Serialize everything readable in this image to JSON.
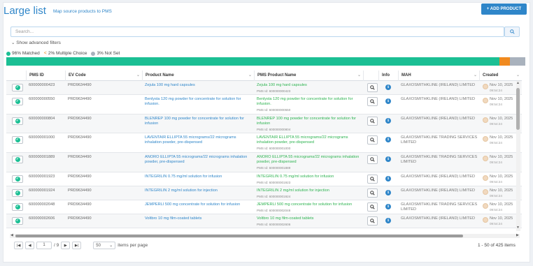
{
  "header": {
    "title": "Large list",
    "subtitle": "Map source products to PMS",
    "add_label": "+ ADD PRODUCT"
  },
  "search": {
    "placeholder": "Search..."
  },
  "filters": {
    "advanced_label": "Show advanced filters"
  },
  "stats": {
    "matched": "96% Matched",
    "multiple": "2% Multiple Choice",
    "not_set": "3% Not Set",
    "matched_fraction": 0.96,
    "multiple_fraction": 0.02,
    "not_set_fraction": 0.03
  },
  "columns": {
    "pms_id": "PMS ID",
    "ev_code": "EV Code",
    "product_name": "Product Name",
    "pms_product_name": "PMS Product Name",
    "info": "Info",
    "mah": "MAH",
    "created": "Created"
  },
  "rows": [
    {
      "pms_id": "600000000423",
      "ev_code": "PRD9634490",
      "product": "Zejula 100 mg hard capsules",
      "pms_product": "Zejula 100 mg hard capsules",
      "pms_sub": "PMS Id: 600000000423",
      "mah": "GLAXOSMITHKLINE (IRELAND) LIMITED",
      "date": "Nov 10, 2025",
      "time": "09:54:24"
    },
    {
      "pms_id": "600000000550",
      "ev_code": "PRD9634490",
      "product": "Benlysta 120 mg powder for concentrate for solution for infusion.",
      "pms_product": "Benlysta 120 mg powder for concentrate for solution for infusion.",
      "pms_sub": "PMS Id: 600000000550",
      "mah": "GLAXOSMITHKLINE (IRELAND) LIMITED",
      "date": "Nov 10, 2025",
      "time": "09:54:24"
    },
    {
      "pms_id": "600000000804",
      "ev_code": "PRD9634490",
      "product": "BLENREP 100 mg powder for concentrate for solution for infusion",
      "pms_product": "BLENREP 100 mg powder for concentrate for solution for infusion",
      "pms_sub": "PMS Id: 600000000804",
      "mah": "GLAXOSMITHKLINE (IRELAND) LIMITED",
      "date": "Nov 10, 2025",
      "time": "09:54:24"
    },
    {
      "pms_id": "600000001000",
      "ev_code": "PRD9634490",
      "product": "LAVENTAIR ELLIPTA 55 micrograms/22 micrograms inhalation powder, pre-dispensed",
      "pms_product": "LAVENTAIR ELLIPTA 55 micrograms/22 micrograms inhalation powder, pre-dispensed",
      "pms_sub": "PMS Id: 600000001000",
      "mah": "GLAXOSMITHKLINE TRADING SERVICES LIMITED",
      "date": "Nov 10, 2025",
      "time": "09:54:24"
    },
    {
      "pms_id": "600000001889",
      "ev_code": "PRD9634490",
      "product": "ANORO ELLIPTA 55 micrograms/22 micrograms inhalation powder, pre-dispensed",
      "pms_product": "ANORO ELLIPTA 55 micrograms/22 micrograms inhalation powder, pre-dispensed",
      "pms_sub": "PMS Id: 600000001889",
      "mah": "GLAXOSMITHKLINE TRADING SERVICES LIMITED",
      "date": "Nov 10, 2025",
      "time": "09:54:24"
    },
    {
      "pms_id": "600000001923",
      "ev_code": "PRD9634490",
      "product": "INTEGRILIN 0.75 mg/ml solution for infusion",
      "pms_product": "INTEGRILIN 0.75 mg/ml solution for infusion",
      "pms_sub": "PMS Id: 600000001923",
      "mah": "GLAXOSMITHKLINE (IRELAND) LIMITED",
      "date": "Nov 10, 2025",
      "time": "09:54:24"
    },
    {
      "pms_id": "600000001924",
      "ev_code": "PRD9634490",
      "product": "INTEGRILIN 2 mg/ml solution for injection",
      "pms_product": "INTEGRILIN 2 mg/ml solution for injection",
      "pms_sub": "PMS Id: 600000001924",
      "mah": "GLAXOSMITHKLINE (IRELAND) LIMITED",
      "date": "Nov 10, 2025",
      "time": "09:54:24"
    },
    {
      "pms_id": "600000002048",
      "ev_code": "PRD9634490",
      "product": "JEMPERLI 500 mg concentrate for solution for infusion",
      "pms_product": "JEMPERLI 500 mg concentrate for solution for infusion",
      "pms_sub": "PMS Id: 600000002048",
      "mah": "GLAXOSMITHKLINE TRADING SERVICES LIMITED",
      "date": "Nov 10, 2025",
      "time": "09:54:24"
    },
    {
      "pms_id": "600000002606",
      "ev_code": "PRD9634490",
      "product": "Voltbro 10 mg film-coated tablets",
      "pms_product": "Voltbro 10 mg film-coated tablets",
      "pms_sub": "PMS Id: 600000002606",
      "mah": "GLAXOSMITHKLINE (IRELAND) LIMITED",
      "date": "Nov 10, 2025",
      "time": "09:54:24"
    }
  ],
  "pager": {
    "page": "1",
    "of_label": "/ 9",
    "page_size": "50",
    "per_page_label": "items per page",
    "items_info": "1 - 50 of 425 items"
  },
  "colors": {
    "accent": "#2f86c9",
    "matched": "#1bbf94",
    "multiple": "#f08a1f",
    "not_set": "#a9b2bd",
    "pms_green": "#2db350"
  },
  "icons": {
    "check": "check-circle-icon",
    "search": "magnifier-icon",
    "info": "info-icon",
    "avatar": "user-avatar-icon"
  }
}
